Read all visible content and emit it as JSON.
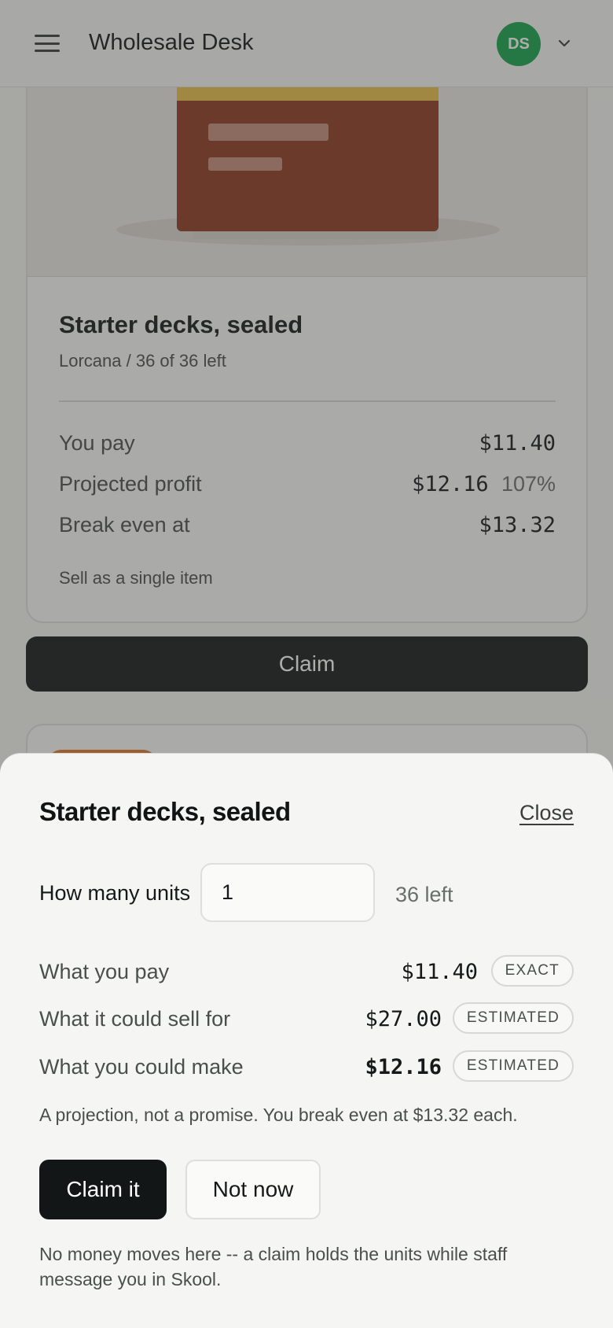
{
  "header": {
    "app_title": "Wholesale Desk",
    "avatar_initials": "DS",
    "avatar_color": "#16a34a"
  },
  "card": {
    "title": "Starter decks, sealed",
    "subtitle": "Lorcana / 36 of 36 left",
    "rows": [
      {
        "label": "You pay",
        "value": "$11.40"
      },
      {
        "label": "Projected profit",
        "value": "$12.16",
        "percent": "107%"
      },
      {
        "label": "Break even at",
        "value": "$13.32"
      }
    ],
    "note": "Sell as a single item",
    "claim_label": "Claim"
  },
  "sheet": {
    "title": "Starter decks, sealed",
    "close_label": "Close",
    "quantity_label": "How many units",
    "quantity_value": "1",
    "units_left": "36 left",
    "rows": [
      {
        "label": "What you pay",
        "amount": "$11.40",
        "badge": "EXACT"
      },
      {
        "label": "What it could sell for",
        "amount": "$27.00",
        "badge": "ESTIMATED"
      },
      {
        "label": "What you could make",
        "amount": "$12.16",
        "badge": "ESTIMATED"
      }
    ],
    "note": "A projection, not a promise. You break even at $13.32 each.",
    "primary_label": "Claim it",
    "secondary_label": "Not now",
    "footer": "No money moves here -- a claim holds the units while staff message you in Skool."
  }
}
